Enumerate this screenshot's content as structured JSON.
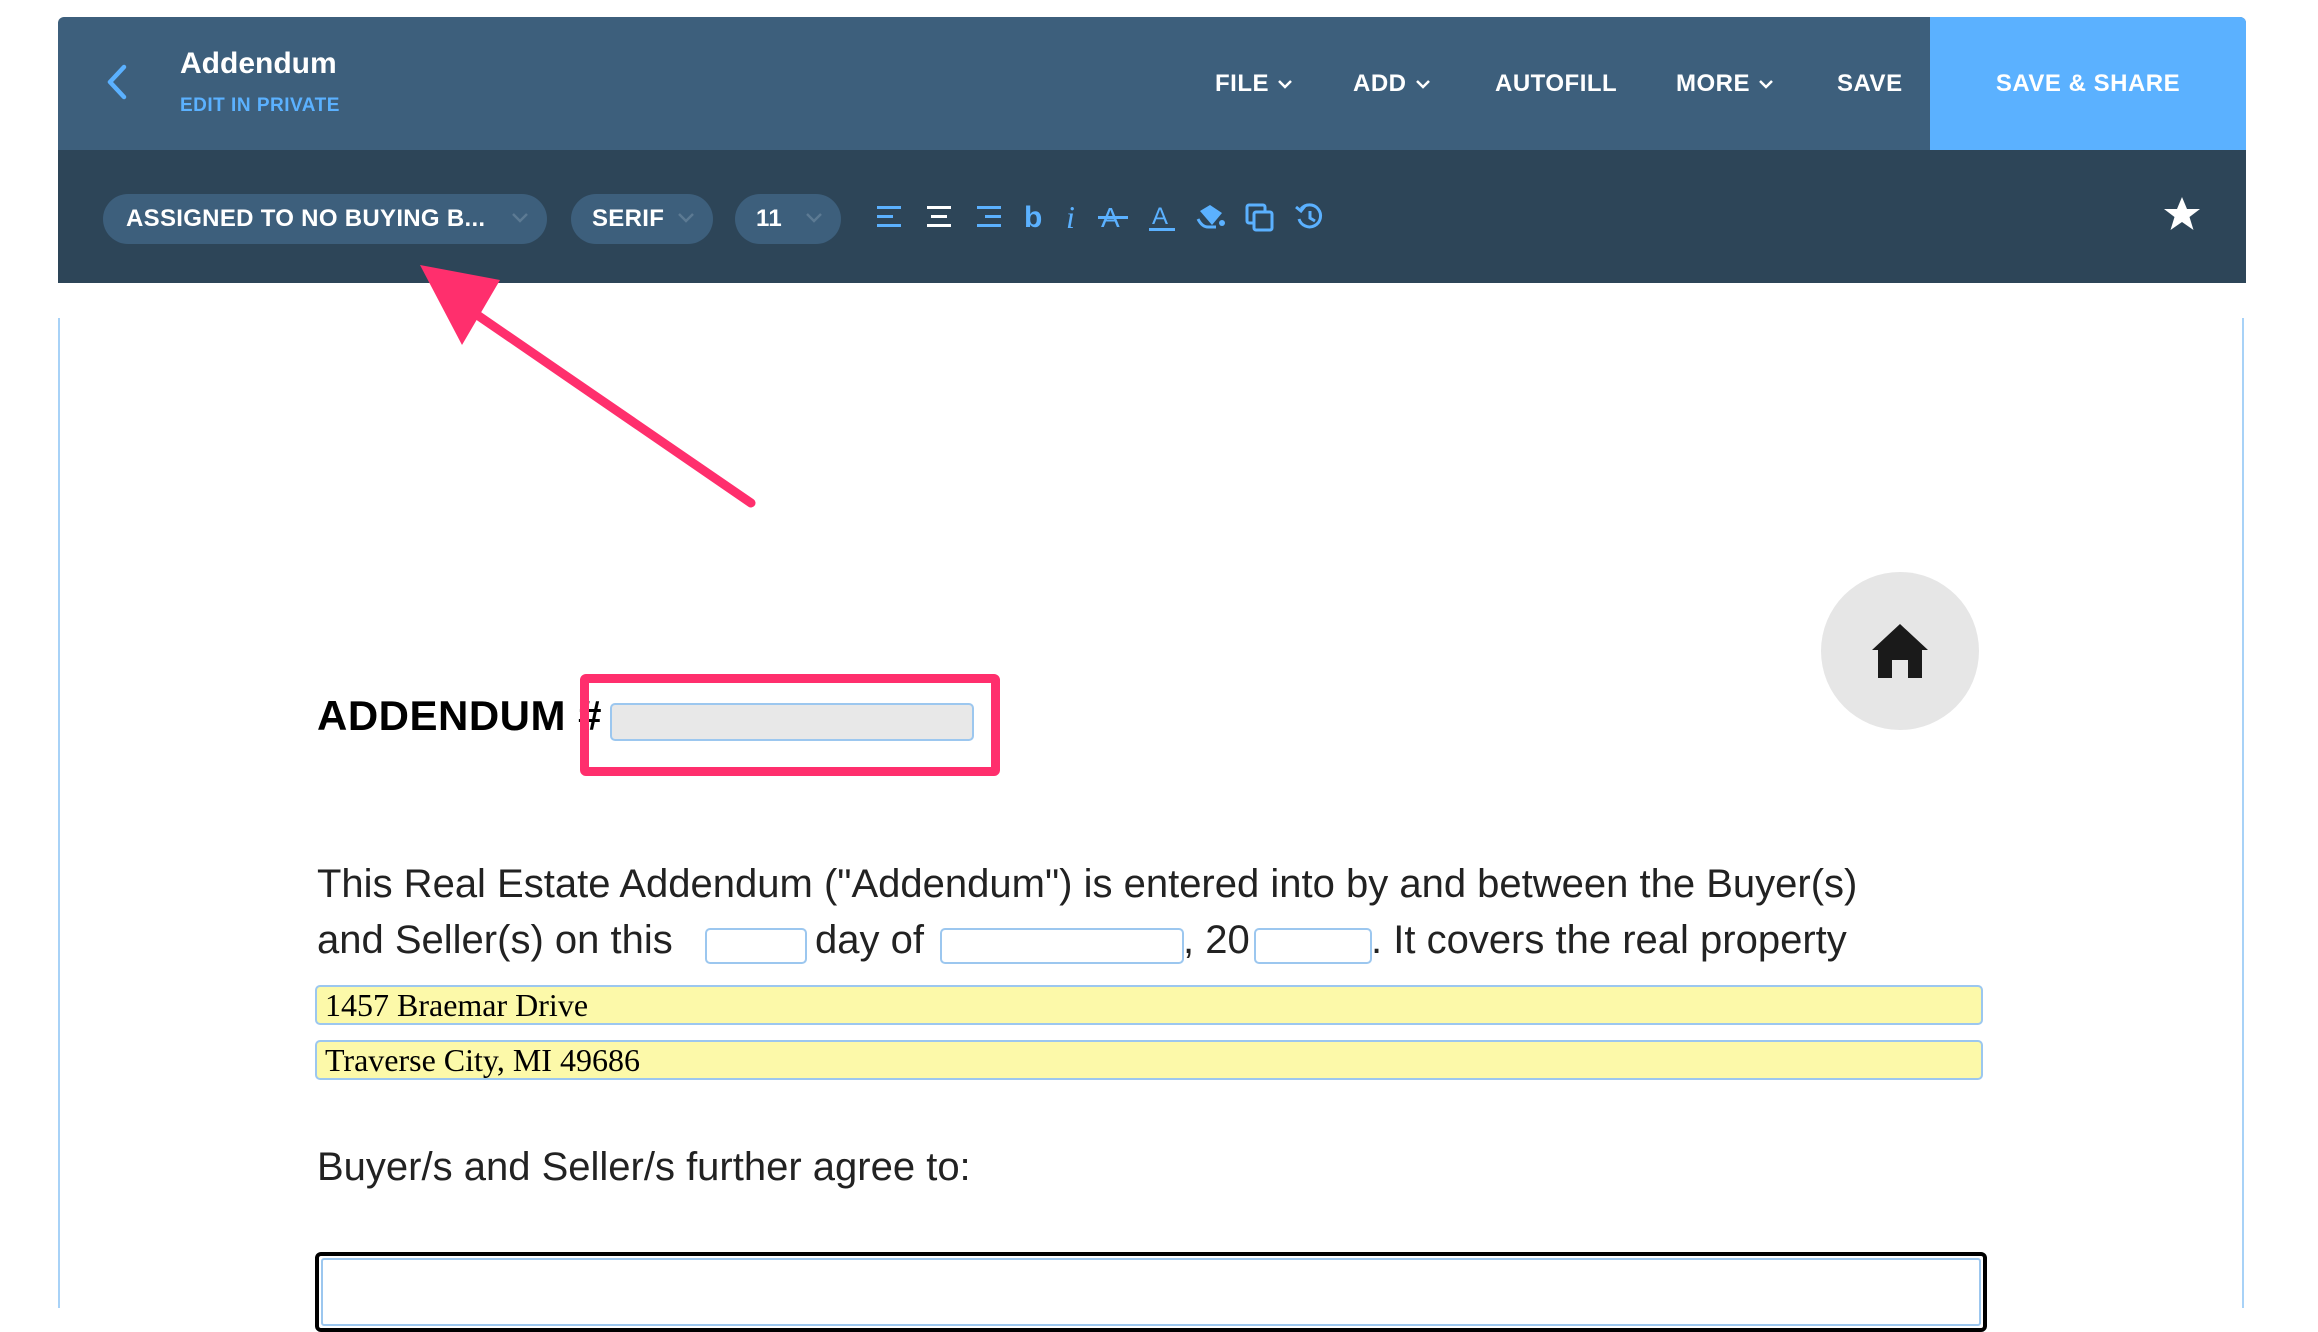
{
  "header": {
    "title": "Addendum",
    "subtitle": "EDIT IN PRIVATE",
    "menu": {
      "file": "FILE",
      "add": "ADD",
      "autofill": "AUTOFILL",
      "more": "MORE",
      "save": "SAVE"
    },
    "save_share": "SAVE & SHARE"
  },
  "toolbar": {
    "assignee": "ASSIGNED TO NO BUYING B...",
    "font": "SERIF",
    "font_size": "11",
    "icons": [
      "align-left-icon",
      "align-center-icon",
      "align-right-icon",
      "bold-icon",
      "italic-icon",
      "strikethrough-icon",
      "underline-icon",
      "fill-icon",
      "duplicate-icon",
      "history-icon",
      "star-icon"
    ]
  },
  "document": {
    "heading": "ADDENDUM #",
    "addendum_number": "",
    "para1_line1": "This Real Estate Addendum (\"Addendum\") is entered into by and between the Buyer(s)",
    "para1_line2_a": "and Seller(s) on this",
    "para1_line2_b": "day of",
    "para1_line2_c": ", 20",
    "para1_line2_d": ". It covers the real property",
    "day_value": "",
    "month_value": "",
    "year_value": "",
    "address_line1": "1457 Braemar Drive",
    "address_line2": "Traverse City, MI 49686",
    "agree_label": "Buyer/s and Seller/s further agree to:",
    "agree_value": ""
  },
  "colors": {
    "header_bg": "#3d5f7c",
    "toolbar_bg": "#2d4558",
    "accent": "#5bb1ff",
    "highlight": "#ff2f6d",
    "address_fill": "#fcf9a9"
  }
}
